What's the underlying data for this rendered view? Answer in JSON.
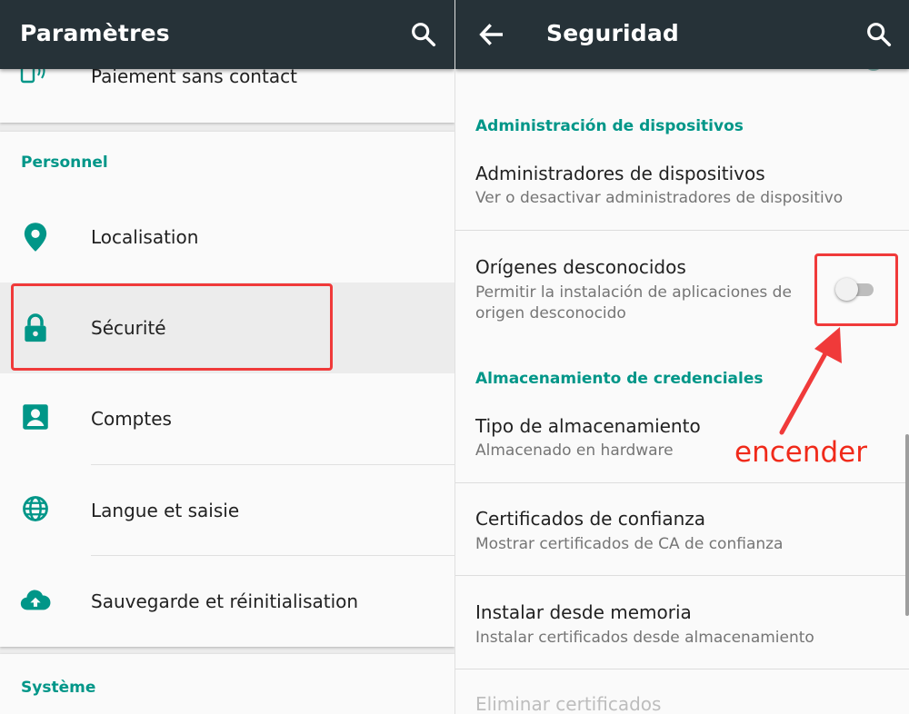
{
  "left_panel": {
    "app_bar": {
      "title": "Paramètres",
      "search_icon": "search-icon"
    },
    "top_item": {
      "label": "Paiement sans contact",
      "icon": "nfc-phone-icon"
    },
    "personal_section": {
      "header": "Personnel",
      "items": [
        {
          "label": "Localisation",
          "icon": "location-pin-icon"
        },
        {
          "label": "Sécurité",
          "icon": "lock-icon"
        },
        {
          "label": "Comptes",
          "icon": "account-box-icon"
        },
        {
          "label": "Langue et saisie",
          "icon": "globe-icon"
        },
        {
          "label": "Sauvegarde et réinitialisation",
          "icon": "cloud-upload-icon"
        }
      ]
    },
    "system_section": {
      "header": "Système"
    }
  },
  "right_panel": {
    "app_bar": {
      "title": "Seguridad",
      "back_icon": "arrow-back-icon",
      "search_icon": "search-icon"
    },
    "device_admin": {
      "header": "Administración de dispositivos",
      "items": [
        {
          "title": "Administradores de dispositivos",
          "subtitle": "Ver o desactivar administradores de dispositivo"
        }
      ]
    },
    "unknown_sources": {
      "title": "Orígenes desconocidos",
      "subtitle_line1": "Permitir la instalación de aplicaciones de",
      "subtitle_line2": "origen desconocido",
      "toggle_state": "off"
    },
    "credential_storage": {
      "header": "Almacenamiento de credenciales",
      "items": [
        {
          "title": "Tipo de almacenamiento",
          "subtitle": "Almacenado en hardware"
        },
        {
          "title": "Certificados de confianza",
          "subtitle": "Mostrar certificados de CA de confianza"
        },
        {
          "title": "Instalar desde memoria",
          "subtitle": "Instalar certificados desde almacenamiento"
        },
        {
          "title": "Eliminar certificados"
        }
      ]
    }
  },
  "annotation": {
    "label": "encender",
    "color": "#f03a3a"
  },
  "colors": {
    "accent": "#009688",
    "app_bar": "#263238"
  }
}
